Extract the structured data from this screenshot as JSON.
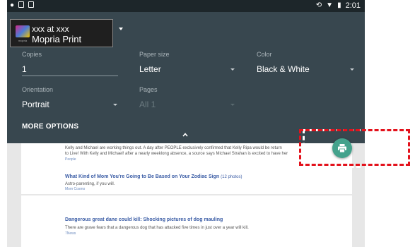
{
  "status_bar": {
    "time": "2:01",
    "icons": [
      "notification-icon",
      "cast-icon",
      "sim-icon",
      "sync-icon",
      "wifi-icon",
      "battery-icon"
    ]
  },
  "printer": {
    "line1": "xxx at xxx",
    "line2": "Mopria Print",
    "logo_text": "mopria"
  },
  "fields": {
    "copies": {
      "label": "Copies",
      "value": "1"
    },
    "paper_size": {
      "label": "Paper size",
      "value": "Letter"
    },
    "color": {
      "label": "Color",
      "value": "Black & White"
    },
    "orientation": {
      "label": "Orientation",
      "value": "Portrait"
    },
    "pages": {
      "label": "Pages",
      "value": "All 1"
    }
  },
  "more_options": "MORE OPTIONS",
  "background": {
    "item1": {
      "snippet_line1": "Kelly and Michael are working things out. A day after PEOPLE exclusively confirmed that Kelly Ripa would be return",
      "snippet_line2": "to Live! With Kelly and Michael! after a nearly weeklong absence, a source says Michael Strahan is excited to have her",
      "source": "People"
    },
    "item2": {
      "headline": "What Kind of Mom You're Going to Be Based on Your Zodiac Sign",
      "count": "(12 photos)",
      "snippet": "Astro-parenting, if you will.",
      "source": "Mom Cosmo"
    },
    "item3": {
      "headline": "Dangerous great dane could kill: Shocking pictures of dog mauling",
      "snippet": "There are grave fears that a dangerous dog that has attacked five times in just over a year will kill.",
      "source": "7News"
    }
  },
  "colors": {
    "panel": "#38474f",
    "fab": "#44a28c",
    "highlight": "#e3111b"
  }
}
